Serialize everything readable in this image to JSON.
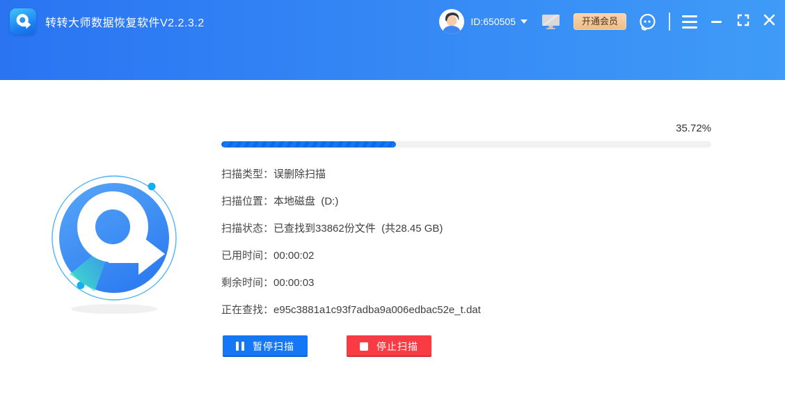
{
  "window": {
    "title": "转转大师数据恢复软件V2.2.3.2",
    "controls": {
      "menu": "menu",
      "minimize": "minimize",
      "maximize": "maximize",
      "close": "close"
    }
  },
  "header": {
    "user_id": "ID:650505",
    "vip_button_label": "开通会员",
    "icons": [
      "avatar",
      "dropdown-caret",
      "monitor-icon",
      "support-headset-icon",
      "menu-icon",
      "minimize-icon",
      "maximize-icon",
      "close-icon"
    ]
  },
  "scan": {
    "percent_label": "35.72%",
    "percent_value": 35.72,
    "details": [
      {
        "label": "扫描类型：",
        "value": "误删除扫描"
      },
      {
        "label": "扫描位置：",
        "value": "本地磁盘  (D:)"
      },
      {
        "label": "扫描状态：",
        "value": "已查找到33862份文件  (共28.45 GB)"
      },
      {
        "label": "已用时间：",
        "value": "00:00:02"
      },
      {
        "label": "剩余时间：",
        "value": "00:00:03"
      },
      {
        "label": "正在查找：",
        "value": "e95c3881a1c93f7adba9a006edbac52e_t.dat"
      }
    ],
    "pause_button_label": "暂停扫描",
    "stop_button_label": "停止扫描"
  },
  "colors": {
    "header_gradient_start": "#2a74f2",
    "header_gradient_end": "#3f9bf7",
    "accent_blue": "#1677f6",
    "danger_red": "#f93b44",
    "vip_button_bg": "#f2c896",
    "vip_button_text": "#4a3422",
    "progress_fill": "#1b7df5",
    "progress_track": "#f1f1f1",
    "logo_blue": "#3a8af3",
    "logo_teal": "#3fe6c3"
  }
}
